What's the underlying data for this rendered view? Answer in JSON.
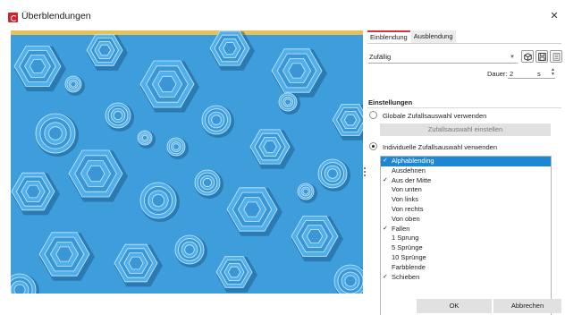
{
  "window": {
    "title": "Überblendungen"
  },
  "tabs": [
    {
      "label": "Einblendung",
      "active": true
    },
    {
      "label": "Ausblendung",
      "active": false
    }
  ],
  "transition": {
    "selected_value": "Zufällig",
    "duration_label": "Dauer:",
    "duration_value": "2",
    "duration_unit": "s"
  },
  "settings": {
    "title": "Einstellungen",
    "global_option_label": "Globale Zufallsauswahl verwenden",
    "global_option_checked": false,
    "configure_button_label": "Zufallsauswahl einstellen",
    "individual_option_label": "Individuelle Zufallsauswahl verwenden",
    "individual_option_checked": true
  },
  "transition_list": [
    {
      "label": "Alphablending",
      "checked": true,
      "selected": true
    },
    {
      "label": "Ausdehnen",
      "checked": false,
      "selected": false
    },
    {
      "label": "Aus der Mitte",
      "checked": true,
      "selected": false
    },
    {
      "label": "Von unten",
      "checked": false,
      "selected": false
    },
    {
      "label": "Von links",
      "checked": false,
      "selected": false
    },
    {
      "label": "Von rechts",
      "checked": false,
      "selected": false
    },
    {
      "label": "Von oben",
      "checked": false,
      "selected": false
    },
    {
      "label": "Fallen",
      "checked": true,
      "selected": false
    },
    {
      "label": "1 Sprung",
      "checked": false,
      "selected": false
    },
    {
      "label": "5 Sprünge",
      "checked": false,
      "selected": false
    },
    {
      "label": "10 Sprünge",
      "checked": false,
      "selected": false
    },
    {
      "label": "Farbblende",
      "checked": false,
      "selected": false
    },
    {
      "label": "Schieben",
      "checked": true,
      "selected": false
    }
  ],
  "footer": {
    "ok_label": "OK",
    "cancel_label": "Abbrechen"
  },
  "icons": {
    "app": "app-logo-icon",
    "close": "close-icon",
    "cube": "cube-icon",
    "save": "save-icon",
    "list": "list-icon"
  },
  "colors": {
    "accent": "#d8333a",
    "selection": "#1d87d4",
    "preview_blue": "#3e9ddb"
  }
}
